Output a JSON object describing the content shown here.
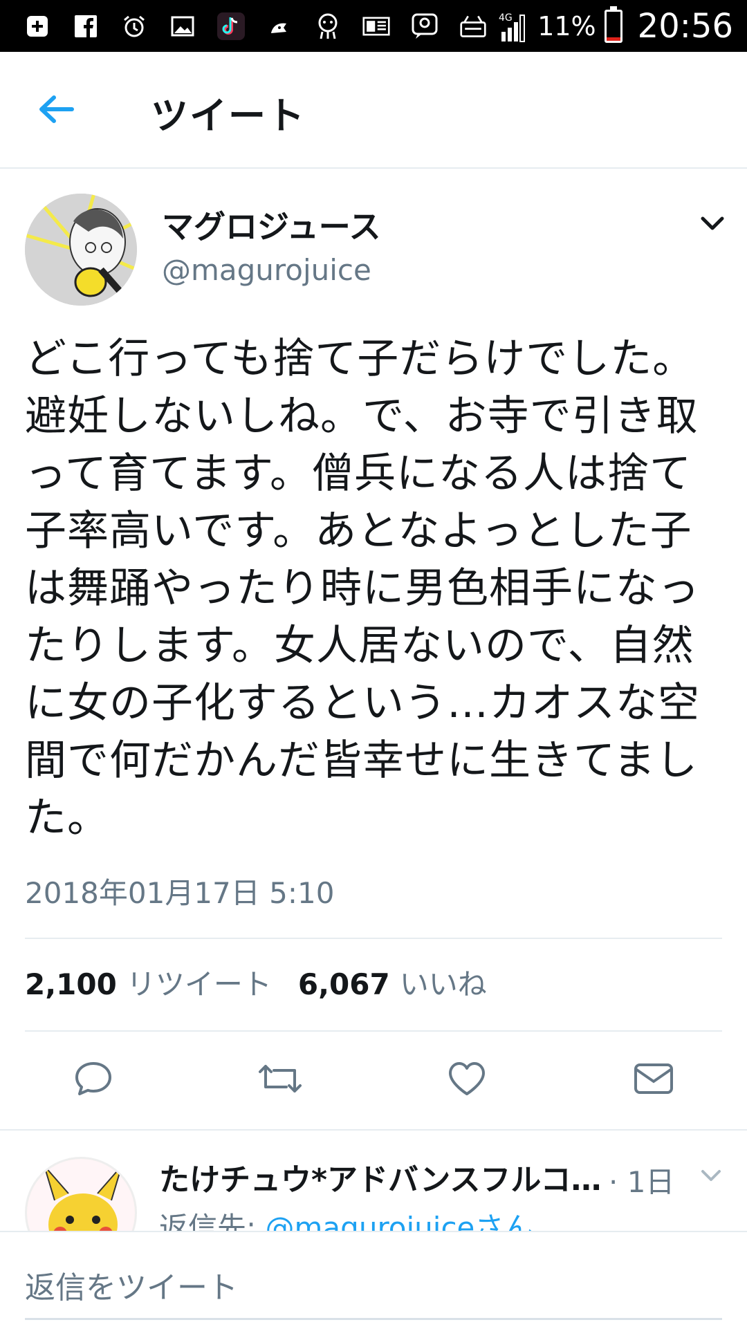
{
  "status_bar": {
    "icons": [
      "plus-box-icon",
      "facebook-icon",
      "alarm-icon",
      "image-icon",
      "tiktok-icon",
      "cat-icon",
      "character-icon",
      "news-icon",
      "chat-face-icon",
      "market-icon"
    ],
    "network": "4G",
    "battery_pct": "11%",
    "battery_level": 0.11,
    "time": "20:56"
  },
  "header": {
    "title": "ツイート"
  },
  "tweet": {
    "display_name": "マグロジュース",
    "handle": "@magurojuice",
    "text": "どこ行っても捨て子だらけでした。避妊しないしね。で、お寺で引き取って育てます。僧兵になる人は捨て子率高いです。あとなよっとした子は舞踊やったり時に男色相手になったりします。女人居ないので、自然に女の子化するという…カオスな空間で何だかんだ皆幸せに生きてました。",
    "timestamp": "2018年01月17日 5:10",
    "retweet_count": "2,100",
    "retweet_label": "リツイート",
    "like_count": "6,067",
    "like_label": "いいね"
  },
  "actions": [
    "reply-icon",
    "retweet-icon",
    "like-icon",
    "dm-icon"
  ],
  "reply": {
    "display_name": "たけチュウ*アドバンスフルコ…",
    "time": "· 1日",
    "reply_prefix": "返信先: ",
    "reply_link": "@magurojuiceさん"
  },
  "compose": {
    "placeholder": "返信をツイート"
  },
  "colors": {
    "accent": "#1da1f2",
    "secondary_text": "#657786",
    "divider": "#e6ecf0"
  }
}
